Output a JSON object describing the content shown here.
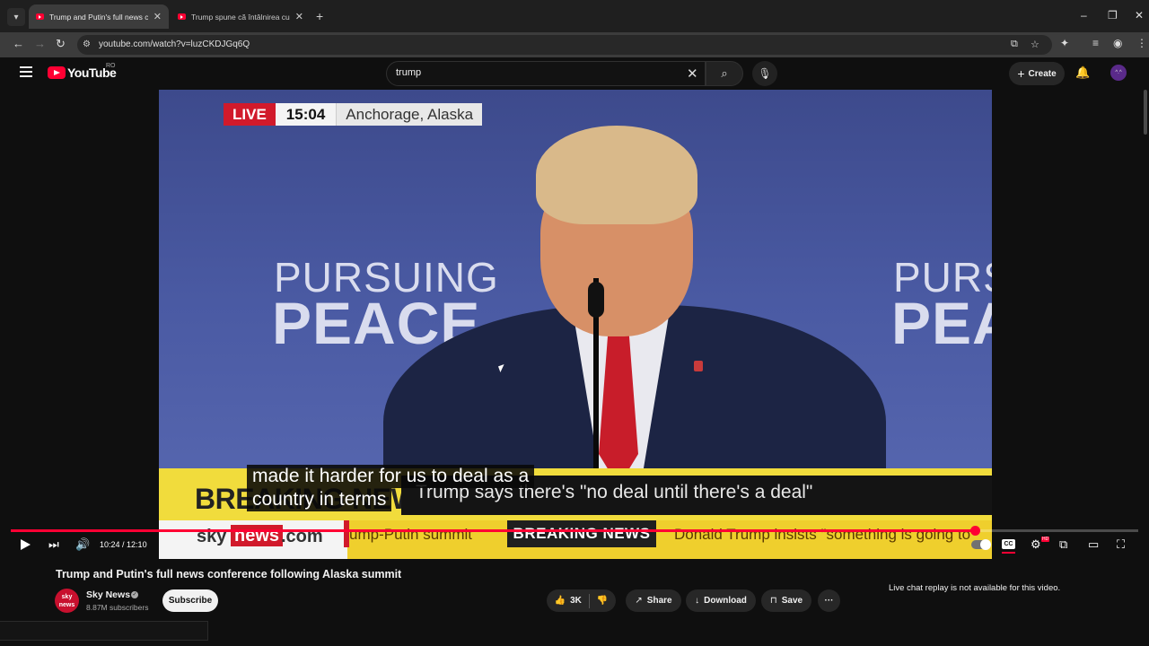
{
  "browser": {
    "tabs": [
      {
        "title": "Trump and Putin's full news conference following Alaska summit",
        "active": true
      },
      {
        "title": "Trump spune că întâlnirea cu Putin",
        "active": false
      }
    ],
    "url": "youtube.com/watch?v=luzCKDJGq6Q",
    "icons": {
      "tab_list": "▾",
      "new_tab": "+",
      "minimize": "–",
      "restore": "❐",
      "close": "✕",
      "back": "←",
      "forward": "→",
      "reload": "↻",
      "site_info": "⚙",
      "install": "⧉",
      "bookmark": "☆",
      "extensions": "✦",
      "media": "≡",
      "profile": "◉",
      "menu": "⋮"
    }
  },
  "youtube": {
    "logo_text": "YouTube",
    "region": "RO",
    "search_value": "trump",
    "create_label": "Create",
    "icons": {
      "clear": "✕",
      "search": "⌕",
      "mic": "🎙",
      "bell": "🔔"
    },
    "avatar_text": "^.^"
  },
  "video": {
    "live_label": "LIVE",
    "live_time": "15:04",
    "live_location": "Anchorage, Alaska",
    "backdrop": {
      "top": "PURSUING",
      "bottom": "PEACE"
    },
    "breaking_big": "BREAKING NEWS",
    "headline": "Trump says there's \"no deal until there's a deal\"",
    "ticker": {
      "logo_a": "sky",
      "logo_b": "news",
      "logo_c": ".com",
      "item1": "ump-Putin summit",
      "breaking": "BREAKING NEWS",
      "item2": "Donald Trump insists \"something is going to"
    },
    "caption_lines": [
      "made it harder for us to deal as a",
      "country in terms"
    ]
  },
  "player": {
    "current_time": "10:24",
    "duration": "12:10",
    "progress": 0.855,
    "time_separator": " / ",
    "hd_badge": "HD",
    "cc_label": "CC",
    "icons": {
      "next": "⏭",
      "volume": "🔊",
      "settings": "⚙",
      "miniplayer": "⧉",
      "theater": "▭",
      "fullscreen": "⛶"
    }
  },
  "watch": {
    "title": "Trump and Putin's full news conference following Alaska summit",
    "channel": {
      "name": "Sky News",
      "subscribers": "8.87M subscribers",
      "avatar_text": "sky news"
    },
    "subscribe_label": "Subscribe",
    "likes": "3K",
    "share_label": "Share",
    "download_label": "Download",
    "save_label": "Save",
    "more_label": "···",
    "icons": {
      "like": "👍",
      "dislike": "👎",
      "share": "↗",
      "download": "↓",
      "save": "⊓"
    },
    "chat_note": "Live chat replay is not available for this video."
  }
}
